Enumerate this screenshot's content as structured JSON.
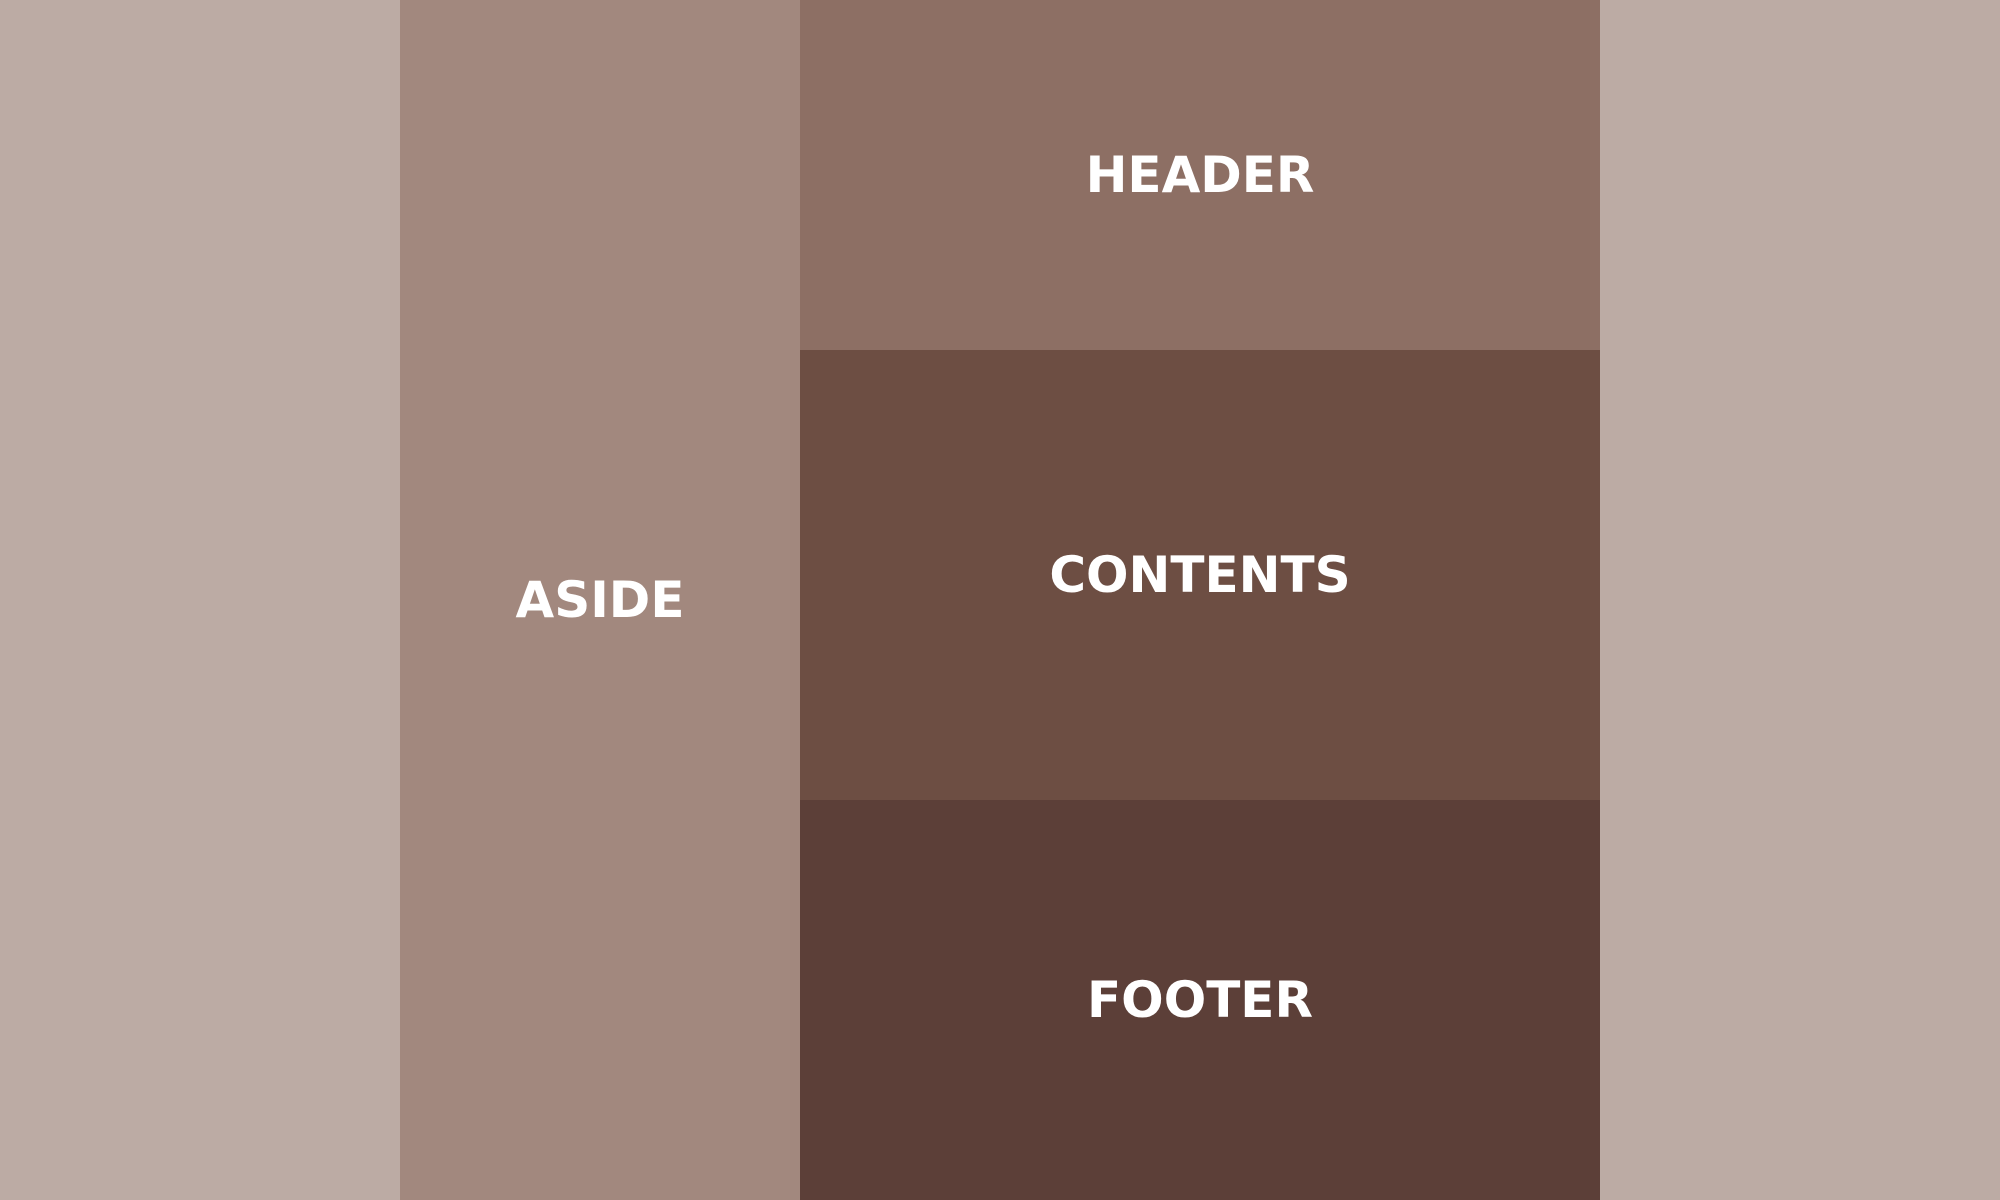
{
  "colors": {
    "page_background": "#bcaba4",
    "aside": "#a2887e",
    "header": "#8d6f64",
    "contents": "#6d4e43",
    "footer": "#5c3f38",
    "text": "#ffffff"
  },
  "layout_regions": {
    "aside_label": "ASIDE",
    "header_label": "HEADER",
    "contents_label": "CONTENTS",
    "footer_label": "FOOTER"
  }
}
